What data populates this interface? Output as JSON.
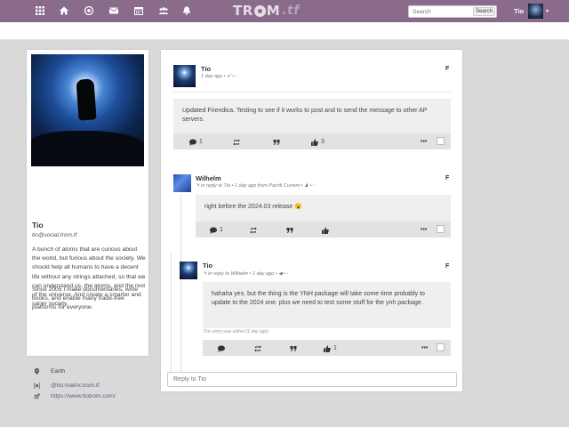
{
  "nav": {
    "icons": [
      "grid-icon",
      "home-icon",
      "network-icon",
      "mail-icon",
      "calendar-icon",
      "people-icon",
      "bell-icon"
    ],
    "logo_text": "TR",
    "logo_text2": "M",
    "logo_tf": ".tf",
    "search_placeholder": "Search",
    "search_button": "Search",
    "user_name": "Tio",
    "accent": "#8a6b8c"
  },
  "profile": {
    "name": "Tio",
    "handle": "tio@social.trom.tf",
    "bio": "A bunch of atoms that are curious about the world, but furious about the society. We should help all humans to have a decent life without any strings attached, so that we can understand us, the atoms, and the rest of the universe. And create a smarter and saner society.",
    "bio2": "Since 2005 I make documentaries, write books, and enable many trade-free platforms for everyone.",
    "location": "Earth",
    "matrix": "@tio:matrix.trom.tf",
    "website": "https://www.tiotrom.com/"
  },
  "posts": [
    {
      "author": "Tio",
      "meta": "1 day ago • ✔ • ◦",
      "network": "F",
      "body": "Updated Friendica. Testing to see if it works to post and to send the message to other AP servers.",
      "comments": "1",
      "likes": "3"
    },
    {
      "author": "Wilhelm",
      "meta": "↰ in reply to Tio • 1 day ago from Pachli Current • ♟ • ◦",
      "network": "F",
      "body": "right before the 2024.03 release 😮",
      "comments": "1",
      "likes": ""
    },
    {
      "author": "Tio",
      "meta": "↰ in reply to Wilhelm • 1 day ago • ◀ • ◦",
      "network": "F",
      "body": "hahaha yes. but the thing is the YNH package will take some time probably to update to the 2024 one. plus we need to test some stuff for the ynh package.",
      "edited": "This entry was edited (1 day ago)",
      "comments": "",
      "likes": "1"
    }
  ],
  "reply_placeholder": "Reply to Tio"
}
